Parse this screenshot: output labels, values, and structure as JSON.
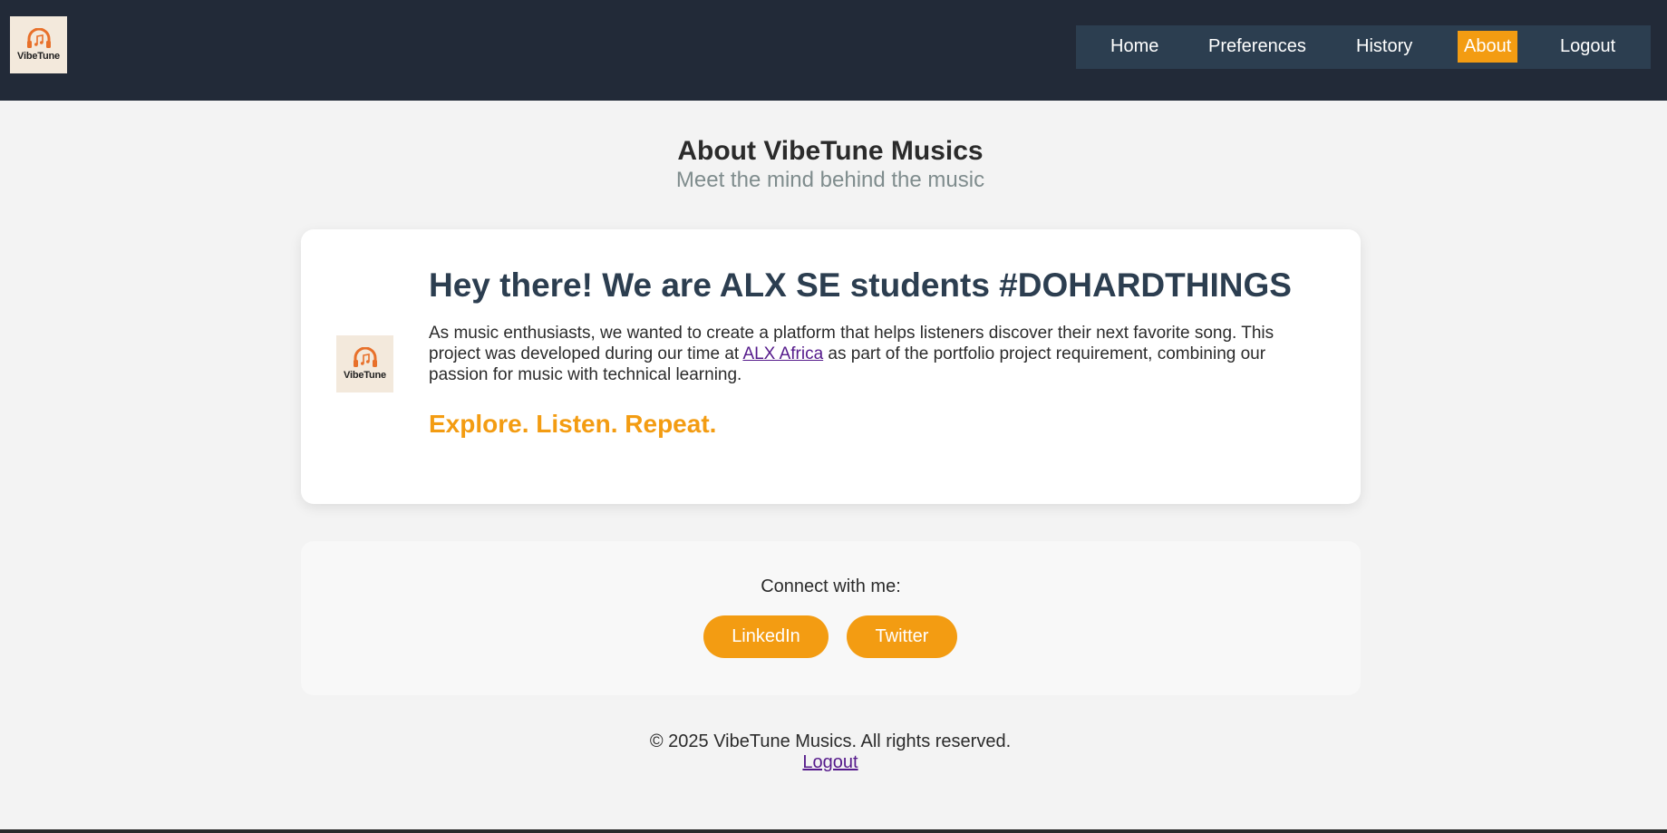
{
  "brand": {
    "logo_text": "VibeTune",
    "icon": "headphones-music-icon",
    "accent_color": "#f39c12"
  },
  "nav": {
    "items": [
      {
        "label": "Home"
      },
      {
        "label": "Preferences"
      },
      {
        "label": "History"
      },
      {
        "label": "About",
        "active": true
      },
      {
        "label": "Logout"
      }
    ]
  },
  "page": {
    "title": "About VibeTune Musics",
    "subtitle": "Meet the mind behind the music"
  },
  "card": {
    "heading": "Hey there! We are ALX SE students #DOHARDTHINGS",
    "body_before_link": "As music enthusiasts, we wanted to create a platform that helps listeners discover their next favorite song. This project was developed during our time at ",
    "link_text": "ALX Africa",
    "body_after_link": " as part of the portfolio project requirement, combining our passion for music with technical learning.",
    "tagline": "Explore. Listen. Repeat."
  },
  "connect": {
    "label": "Connect with me:",
    "buttons": [
      {
        "label": "LinkedIn"
      },
      {
        "label": "Twitter"
      }
    ]
  },
  "footer": {
    "copyright": "© 2025 VibeTune Musics. All rights reserved.",
    "logout_label": "Logout"
  }
}
